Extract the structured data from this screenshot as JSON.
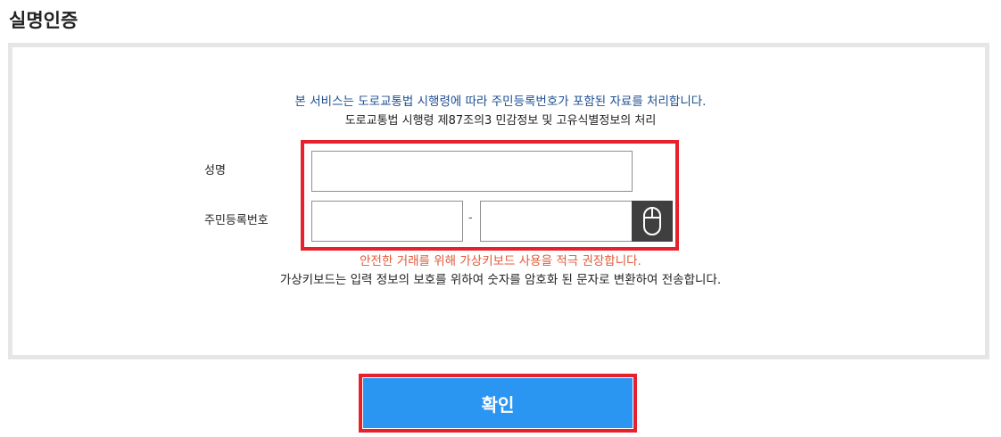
{
  "page": {
    "title": "실명인증"
  },
  "notices": {
    "service_notice": "본 서비스는 도로교통법 시행령에 따라 주민등록번호가 포함된 자료를 처리합니다.",
    "legal_basis": "도로교통법 시행령 제87조의3 민감정보 및 고유식별정보의 처리",
    "keyboard_recommend": "안전한 거래를 위해 가상키보드 사용을 적극 권장합니다.",
    "keyboard_description": "가상키보드는 입력 정보의 보호를 위하여 숫자를 암호화 된 문자로 변환하여 전송합니다."
  },
  "form": {
    "name_label": "성명",
    "name_value": "",
    "rrn_label": "주민등록번호",
    "rrn_front_value": "",
    "rrn_separator": "-",
    "rrn_back_value": "",
    "keyboard_icon": "mouse-icon"
  },
  "actions": {
    "confirm_label": "확인"
  },
  "colors": {
    "notice_blue": "#1d4f91",
    "notice_red": "#e05a3b",
    "highlight_red": "#e8202b",
    "confirm_blue": "#2b95f2",
    "keyboard_dark": "#3f3f3f"
  }
}
